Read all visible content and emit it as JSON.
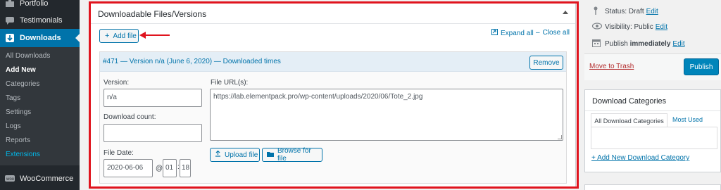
{
  "sidebar": {
    "top_items": [
      {
        "label": "Portfolio",
        "icon": "portfolio-icon"
      },
      {
        "label": "Testimonials",
        "icon": "testimonials-icon"
      },
      {
        "label": "Downloads",
        "icon": "downloads-icon"
      }
    ],
    "sub_items": [
      "All Downloads",
      "Add New",
      "Categories",
      "Tags",
      "Settings",
      "Logs",
      "Reports",
      "Extensions"
    ],
    "current_sub": "Add New",
    "bottom_item": {
      "label": "WooCommerce",
      "icon": "woocommerce-icon"
    }
  },
  "metabox": {
    "title": "Downloadable Files/Versions",
    "add_file": "Add file",
    "expand_all": "Expand all",
    "close_all": "Close all"
  },
  "file": {
    "header": "#471 — Version n/a (June 6, 2020) — Downloaded times",
    "remove": "Remove",
    "version_label": "Version:",
    "version_value": "n/a",
    "download_count_label": "Download count:",
    "download_count_value": "",
    "file_date_label": "File Date:",
    "file_date_value": "2020-06-06",
    "at": "@",
    "hour": "01",
    "minute": "18",
    "urls_label": "File URL(s):",
    "urls_value": "https://lab.elementpack.pro/wp-content/uploads/2020/06/Tote_2.jpg",
    "upload_file": "Upload file",
    "browse_for_file": "Browse for file"
  },
  "publish": {
    "status_label": "Status:",
    "status_value": "Draft",
    "visibility_label": "Visibility:",
    "visibility_value": "Public",
    "publish_text": "Publish",
    "publish_when": "immediately",
    "edit": "Edit",
    "move_to_trash": "Move to Trash",
    "publish_button": "Publish"
  },
  "categories": {
    "title": "Download Categories",
    "tab_all": "All Download Categories",
    "tab_used": "Most Used",
    "add_new": "+ Add New Download Category"
  },
  "colors": {
    "accent": "#0073aa",
    "sidebar_bg": "#23282d",
    "highlight_red": "#e0141e",
    "trash_red": "#b32d2e"
  }
}
